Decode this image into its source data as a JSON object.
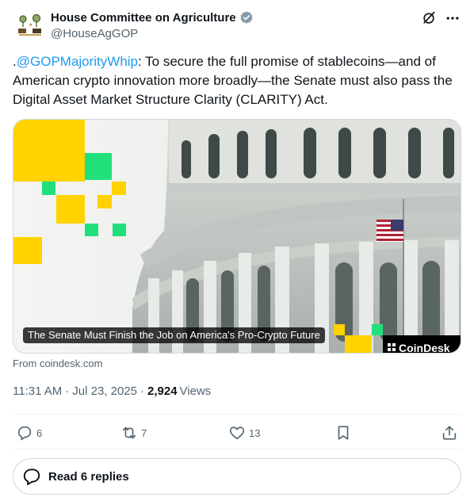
{
  "author": {
    "display_name": "House Committee on Agriculture",
    "handle": "@HouseAgGOP",
    "verified": true,
    "badge_color": "#829aab",
    "avatar_icon": "house-ag-seal"
  },
  "top_icons": [
    "grok-icon",
    "more-icon"
  ],
  "tweet": {
    "prefix": ".",
    "mention": "@GOPMajorityWhip",
    "body": ": To secure the full promise of stablecoins—and of American crypto innovation more broadly—the Senate must also pass the Digital Asset Market Structure Clarity (CLARITY) Act."
  },
  "card": {
    "caption": "The Senate Must Finish the Job on America's Pro-Crypto Future",
    "brand": "CoinDesk",
    "source": "From coindesk.com"
  },
  "meta": {
    "time": "11:31 AM",
    "date": "Jul 23, 2025",
    "views_count": "2,924",
    "views_label": "Views"
  },
  "actions": {
    "replies": "6",
    "reposts": "7",
    "likes": "13",
    "bookmark_icon": "bookmark-icon",
    "share_icon": "share-icon"
  },
  "read_replies": "Read 6 replies",
  "colors": {
    "text": "#0f1419",
    "secondary": "#536471",
    "link": "#1d9bf0",
    "border": "#cfd9de",
    "coindesk_yellow": "#ffd200",
    "coindesk_green": "#21e07c"
  }
}
